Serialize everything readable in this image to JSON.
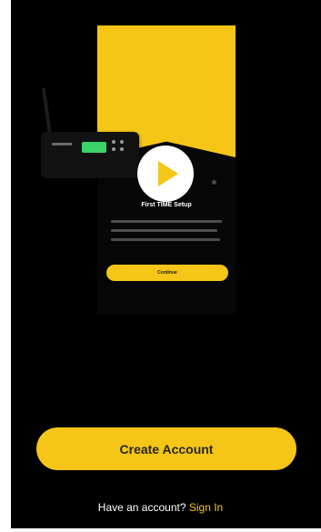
{
  "theme": {
    "background": "#000000",
    "accent": "#f5c518",
    "text": "#ffffff"
  },
  "onboarding": {
    "title": "First TIME Setup",
    "action_label": "Continue"
  },
  "create_account_label": "Create Account",
  "signin": {
    "prompt": "Have an account?",
    "link_label": "Sign In"
  }
}
